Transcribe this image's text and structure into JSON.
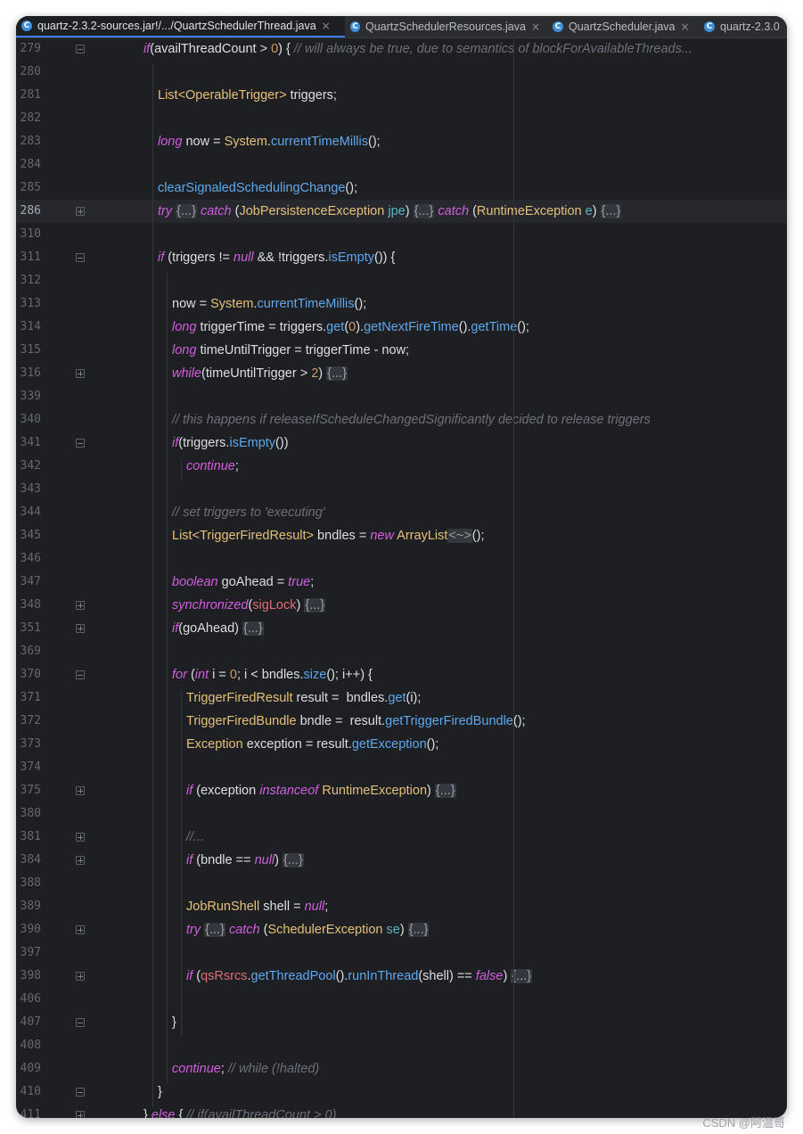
{
  "tabs": [
    {
      "label": "quartz-2.3.2-sources.jar!/.../QuartzSchedulerThread.java",
      "active": true
    },
    {
      "label": "QuartzSchedulerResources.java",
      "active": false
    },
    {
      "label": "QuartzScheduler.java",
      "active": false
    },
    {
      "label": "quartz-2.3.0",
      "active": false
    }
  ],
  "tab_icon_letter": "C",
  "close_glyph": "×",
  "fold_placeholder": "{...}",
  "lines": [
    {
      "n": "279",
      "indent": 0,
      "fold": "open",
      "tokens": [
        [
          "kw",
          "if"
        ],
        [
          "p",
          "("
        ],
        [
          "p",
          "availThreadCount > "
        ],
        [
          "num",
          "0"
        ],
        [
          "p",
          ") { "
        ],
        [
          "cm",
          "// will always be true, due to semantics of blockForAvailableThreads..."
        ]
      ]
    },
    {
      "n": "280",
      "indent": 1,
      "tokens": []
    },
    {
      "n": "281",
      "indent": 1,
      "tokens": [
        [
          "ty",
          "List<OperableTrigger>"
        ],
        [
          "p",
          " triggers;"
        ]
      ]
    },
    {
      "n": "282",
      "indent": 1,
      "tokens": []
    },
    {
      "n": "283",
      "indent": 1,
      "tokens": [
        [
          "kw",
          "long"
        ],
        [
          "p",
          " now = "
        ],
        [
          "ty",
          "System"
        ],
        [
          "p",
          "."
        ],
        [
          "fn",
          "currentTimeMillis"
        ],
        [
          "p",
          "();"
        ]
      ]
    },
    {
      "n": "284",
      "indent": 1,
      "tokens": []
    },
    {
      "n": "285",
      "indent": 1,
      "tokens": [
        [
          "fn",
          "clearSignaledSchedulingChange"
        ],
        [
          "p",
          "();"
        ]
      ]
    },
    {
      "n": "286",
      "indent": 1,
      "current": true,
      "fold": "collapsed",
      "tokens": [
        [
          "kw",
          "try"
        ],
        [
          "p",
          " "
        ],
        [
          "fb",
          "{...}"
        ],
        [
          "p",
          " "
        ],
        [
          "kw",
          "catch"
        ],
        [
          "p",
          " ("
        ],
        [
          "ty",
          "JobPersistenceException"
        ],
        [
          "p",
          " "
        ],
        [
          "pa",
          "jpe"
        ],
        [
          "p",
          ") "
        ],
        [
          "fb",
          "{...}"
        ],
        [
          "p",
          " "
        ],
        [
          "kw",
          "catch"
        ],
        [
          "p",
          " ("
        ],
        [
          "ty",
          "RuntimeException"
        ],
        [
          "p",
          " "
        ],
        [
          "pa",
          "e"
        ],
        [
          "p",
          ") "
        ],
        [
          "fb",
          "{...}"
        ]
      ]
    },
    {
      "n": "310",
      "indent": 1,
      "tokens": []
    },
    {
      "n": "311",
      "indent": 1,
      "fold": "open",
      "tokens": [
        [
          "kw",
          "if"
        ],
        [
          "p",
          " (triggers != "
        ],
        [
          "kw",
          "null"
        ],
        [
          "p",
          " && !triggers."
        ],
        [
          "fn",
          "isEmpty"
        ],
        [
          "p",
          "()) {"
        ]
      ]
    },
    {
      "n": "312",
      "indent": 2,
      "tokens": []
    },
    {
      "n": "313",
      "indent": 2,
      "tokens": [
        [
          "p",
          "now = "
        ],
        [
          "ty",
          "System"
        ],
        [
          "p",
          "."
        ],
        [
          "fn",
          "currentTimeMillis"
        ],
        [
          "p",
          "();"
        ]
      ]
    },
    {
      "n": "314",
      "indent": 2,
      "tokens": [
        [
          "kw",
          "long"
        ],
        [
          "p",
          " triggerTime = triggers."
        ],
        [
          "fn",
          "get"
        ],
        [
          "p",
          "("
        ],
        [
          "num",
          "0"
        ],
        [
          "p",
          ")."
        ],
        [
          "fn",
          "getNextFireTime"
        ],
        [
          "p",
          "()."
        ],
        [
          "fn",
          "getTime"
        ],
        [
          "p",
          "();"
        ]
      ]
    },
    {
      "n": "315",
      "indent": 2,
      "tokens": [
        [
          "kw",
          "long"
        ],
        [
          "p",
          " timeUntilTrigger = triggerTime - now;"
        ]
      ]
    },
    {
      "n": "316",
      "indent": 2,
      "fold": "collapsed",
      "tokens": [
        [
          "kw",
          "while"
        ],
        [
          "p",
          "(timeUntilTrigger > "
        ],
        [
          "num",
          "2"
        ],
        [
          "p",
          ") "
        ],
        [
          "fb",
          "{...}"
        ]
      ]
    },
    {
      "n": "339",
      "indent": 2,
      "tokens": []
    },
    {
      "n": "340",
      "indent": 2,
      "tokens": [
        [
          "cm",
          "// this happens if releaseIfScheduleChangedSignificantly decided to release triggers"
        ]
      ]
    },
    {
      "n": "341",
      "indent": 2,
      "fold": "open",
      "tokens": [
        [
          "kw",
          "if"
        ],
        [
          "p",
          "(triggers."
        ],
        [
          "fn",
          "isEmpty"
        ],
        [
          "p",
          "())"
        ]
      ]
    },
    {
      "n": "342",
      "indent": 3,
      "tokens": [
        [
          "kw",
          "continue"
        ],
        [
          "p",
          ";"
        ]
      ]
    },
    {
      "n": "343",
      "indent": 2,
      "tokens": []
    },
    {
      "n": "344",
      "indent": 2,
      "tokens": [
        [
          "cm",
          "// set triggers to 'executing'"
        ]
      ]
    },
    {
      "n": "345",
      "indent": 2,
      "tokens": [
        [
          "ty",
          "List<TriggerFiredResult>"
        ],
        [
          "p",
          " bndles = "
        ],
        [
          "kw",
          "new"
        ],
        [
          "p",
          " "
        ],
        [
          "ty",
          "ArrayList"
        ],
        [
          "fb",
          "<~>"
        ],
        [
          "p",
          "();"
        ]
      ]
    },
    {
      "n": "346",
      "indent": 2,
      "tokens": []
    },
    {
      "n": "347",
      "indent": 2,
      "tokens": [
        [
          "kw",
          "boolean"
        ],
        [
          "p",
          " goAhead = "
        ],
        [
          "kw",
          "true"
        ],
        [
          "p",
          ";"
        ]
      ]
    },
    {
      "n": "348",
      "indent": 2,
      "fold": "collapsed",
      "tokens": [
        [
          "kw",
          "synchronized"
        ],
        [
          "p",
          "("
        ],
        [
          "va",
          "sigLock"
        ],
        [
          "p",
          ") "
        ],
        [
          "fb",
          "{...}"
        ]
      ]
    },
    {
      "n": "351",
      "indent": 2,
      "fold": "collapsed",
      "tokens": [
        [
          "kw",
          "if"
        ],
        [
          "p",
          "(goAhead) "
        ],
        [
          "fb",
          "{...}"
        ]
      ]
    },
    {
      "n": "369",
      "indent": 2,
      "tokens": []
    },
    {
      "n": "370",
      "indent": 2,
      "fold": "open",
      "tokens": [
        [
          "kw",
          "for"
        ],
        [
          "p",
          " ("
        ],
        [
          "kw",
          "int"
        ],
        [
          "p",
          " i = "
        ],
        [
          "num",
          "0"
        ],
        [
          "p",
          "; i < bndles."
        ],
        [
          "fn",
          "size"
        ],
        [
          "p",
          "(); i++) {"
        ]
      ]
    },
    {
      "n": "371",
      "indent": 3,
      "tokens": [
        [
          "ty",
          "TriggerFiredResult"
        ],
        [
          "p",
          " result =  bndles."
        ],
        [
          "fn",
          "get"
        ],
        [
          "p",
          "(i);"
        ]
      ]
    },
    {
      "n": "372",
      "indent": 3,
      "tokens": [
        [
          "ty",
          "TriggerFiredBundle"
        ],
        [
          "p",
          " bndle =  result."
        ],
        [
          "fn",
          "getTriggerFiredBundle"
        ],
        [
          "p",
          "();"
        ]
      ]
    },
    {
      "n": "373",
      "indent": 3,
      "tokens": [
        [
          "ty",
          "Exception"
        ],
        [
          "p",
          " exception = result."
        ],
        [
          "fn",
          "getException"
        ],
        [
          "p",
          "();"
        ]
      ]
    },
    {
      "n": "374",
      "indent": 3,
      "tokens": []
    },
    {
      "n": "375",
      "indent": 3,
      "fold": "collapsed",
      "tokens": [
        [
          "kw",
          "if"
        ],
        [
          "p",
          " (exception "
        ],
        [
          "kw",
          "instanceof"
        ],
        [
          "p",
          " "
        ],
        [
          "ty",
          "RuntimeException"
        ],
        [
          "p",
          ") "
        ],
        [
          "fb",
          "{...}"
        ]
      ]
    },
    {
      "n": "380",
      "indent": 3,
      "tokens": []
    },
    {
      "n": "381",
      "indent": 3,
      "fold": "collapsed",
      "tokens": [
        [
          "cm",
          "//..."
        ]
      ]
    },
    {
      "n": "384",
      "indent": 3,
      "fold": "collapsed",
      "tokens": [
        [
          "kw",
          "if"
        ],
        [
          "p",
          " (bndle == "
        ],
        [
          "kw",
          "null"
        ],
        [
          "p",
          ") "
        ],
        [
          "fb",
          "{...}"
        ]
      ]
    },
    {
      "n": "388",
      "indent": 3,
      "tokens": []
    },
    {
      "n": "389",
      "indent": 3,
      "tokens": [
        [
          "ty",
          "JobRunShell"
        ],
        [
          "p",
          " shell = "
        ],
        [
          "kw",
          "null"
        ],
        [
          "p",
          ";"
        ]
      ]
    },
    {
      "n": "390",
      "indent": 3,
      "fold": "collapsed",
      "tokens": [
        [
          "kw",
          "try"
        ],
        [
          "p",
          " "
        ],
        [
          "fb",
          "{...}"
        ],
        [
          "p",
          " "
        ],
        [
          "kw",
          "catch"
        ],
        [
          "p",
          " ("
        ],
        [
          "ty",
          "SchedulerException"
        ],
        [
          "p",
          " "
        ],
        [
          "pa",
          "se"
        ],
        [
          "p",
          ") "
        ],
        [
          "fb",
          "{...}"
        ]
      ]
    },
    {
      "n": "397",
      "indent": 3,
      "tokens": []
    },
    {
      "n": "398",
      "indent": 3,
      "fold": "collapsed",
      "tokens": [
        [
          "kw",
          "if"
        ],
        [
          "p",
          " ("
        ],
        [
          "va",
          "qsRsrcs"
        ],
        [
          "p",
          "."
        ],
        [
          "fn",
          "getThreadPool"
        ],
        [
          "p",
          "()."
        ],
        [
          "fn",
          "runInThread"
        ],
        [
          "p",
          "(shell) == "
        ],
        [
          "kw",
          "false"
        ],
        [
          "p",
          ") "
        ],
        [
          "fb",
          "{...}"
        ]
      ]
    },
    {
      "n": "406",
      "indent": 3,
      "tokens": []
    },
    {
      "n": "407",
      "indent": 2,
      "fold": "open",
      "tokens": [
        [
          "p",
          "}"
        ]
      ]
    },
    {
      "n": "408",
      "indent": 2,
      "tokens": []
    },
    {
      "n": "409",
      "indent": 2,
      "tokens": [
        [
          "kw",
          "continue"
        ],
        [
          "p",
          "; "
        ],
        [
          "cm",
          "// while (!halted)"
        ]
      ]
    },
    {
      "n": "410",
      "indent": 1,
      "fold": "open",
      "tokens": [
        [
          "p",
          "}"
        ]
      ]
    },
    {
      "n": "411",
      "indent": 0,
      "fold": "collapsed",
      "tokens": [
        [
          "p",
          "} "
        ],
        [
          "kw",
          "else"
        ],
        [
          "p",
          " { "
        ],
        [
          "cm",
          "// if(availThreadCount > 0)"
        ]
      ]
    }
  ],
  "watermark": "CSDN @阿温哥"
}
